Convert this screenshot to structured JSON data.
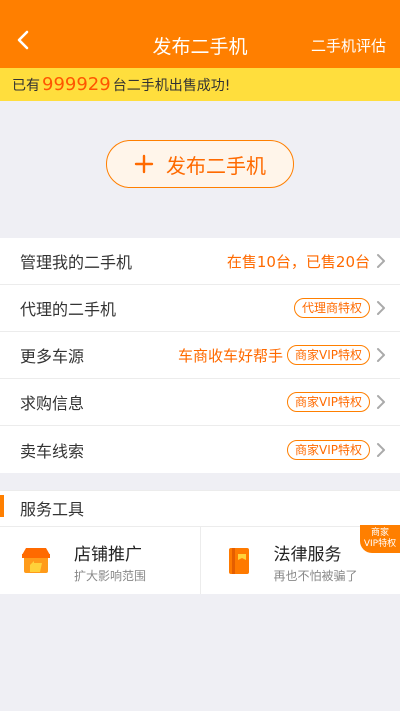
{
  "nav": {
    "title": "发布二手机",
    "right_action": "二手机评估",
    "back_icon": "chevron-left-icon"
  },
  "notice": {
    "prefix": "已有",
    "count": "999929",
    "suffix": "台二手机出售成功!"
  },
  "publish_button": {
    "label": "发布二手机",
    "icon": "plus-icon"
  },
  "menu": [
    {
      "label": "管理我的二手机",
      "extra": "在售10台，已售20台",
      "tag": ""
    },
    {
      "label": "代理的二手机",
      "extra": "",
      "tag": "代理商特权"
    },
    {
      "label": "更多车源",
      "extra": "车商收车好帮手",
      "tag": "商家VIP特权"
    },
    {
      "label": "求购信息",
      "extra": "",
      "tag": "商家VIP特权"
    },
    {
      "label": "卖车线索",
      "extra": "",
      "tag": "商家VIP特权"
    }
  ],
  "services": {
    "title": "服务工具",
    "items": [
      {
        "name": "店铺推广",
        "desc": "扩大影响范围",
        "icon": "store-icon",
        "badge": ""
      },
      {
        "name": "法律服务",
        "desc": "再也不怕被骗了",
        "icon": "law-book-icon",
        "badge_line1": "商家",
        "badge_line2": "VIP特权"
      }
    ]
  },
  "colors": {
    "primary": "#ff7f00",
    "notice_bg": "#ffde3d",
    "accent_text": "#ff6a00"
  }
}
